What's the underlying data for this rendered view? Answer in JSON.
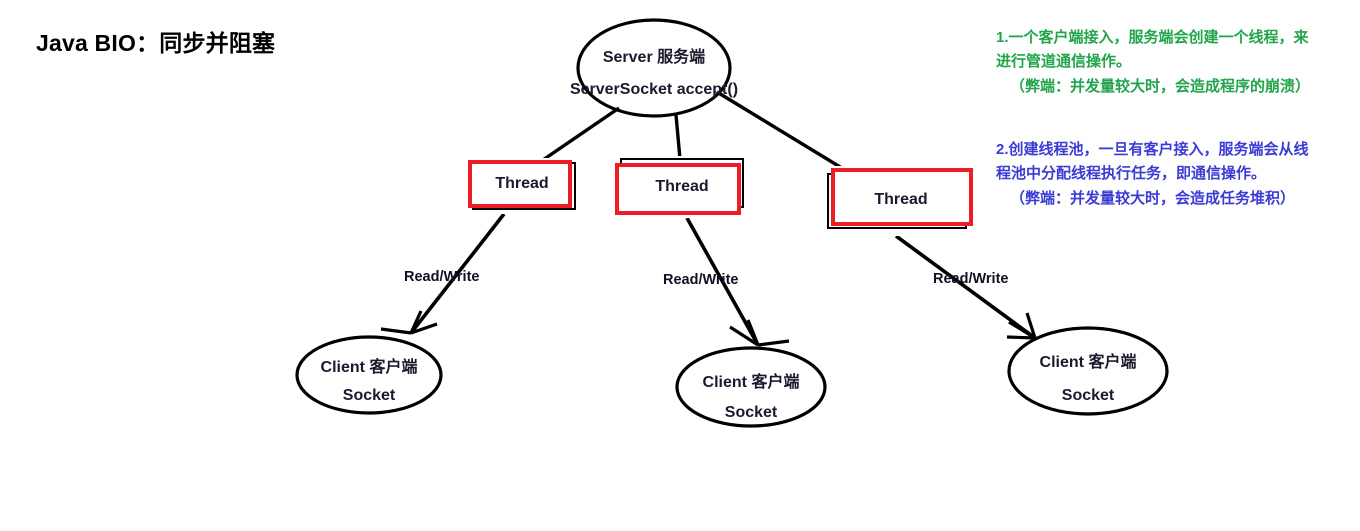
{
  "title": "Java BIO：同步并阻塞",
  "nodes": {
    "server": {
      "line1": "Server 服务端",
      "line2": "ServerSocket  accept()"
    },
    "threads": [
      {
        "label": "Thread"
      },
      {
        "label": "Thread"
      },
      {
        "label": "Thread"
      }
    ],
    "clients": [
      {
        "line1": "Client 客户端",
        "line2": "Socket"
      },
      {
        "line1": "Client 客户端",
        "line2": "Socket"
      },
      {
        "line1": "Client 客户端",
        "line2": "Socket"
      }
    ]
  },
  "edges": {
    "read_write_labels": [
      "Read/Write",
      "Read/Write",
      "Read/Write"
    ]
  },
  "annotations": {
    "green": {
      "color": "#22A44C",
      "lines": [
        "1.一个客户端接入，服务端会创建一个线程，来",
        "进行管道通信操作。",
        "（弊端：并发量较大时，会造成程序的崩溃）"
      ]
    },
    "blue": {
      "color": "#3b3bd6",
      "lines": [
        "2.创建线程池，一旦有客户接入，服务端会从线",
        "程池中分配线程执行任务，即通信操作。",
        "（弊端：并发量较大时，会造成任务堆积）"
      ]
    }
  },
  "colors": {
    "box_border_red": "#ee1c25",
    "box_border_black": "#000000",
    "stroke": "#000000",
    "background": "#ffffff"
  }
}
